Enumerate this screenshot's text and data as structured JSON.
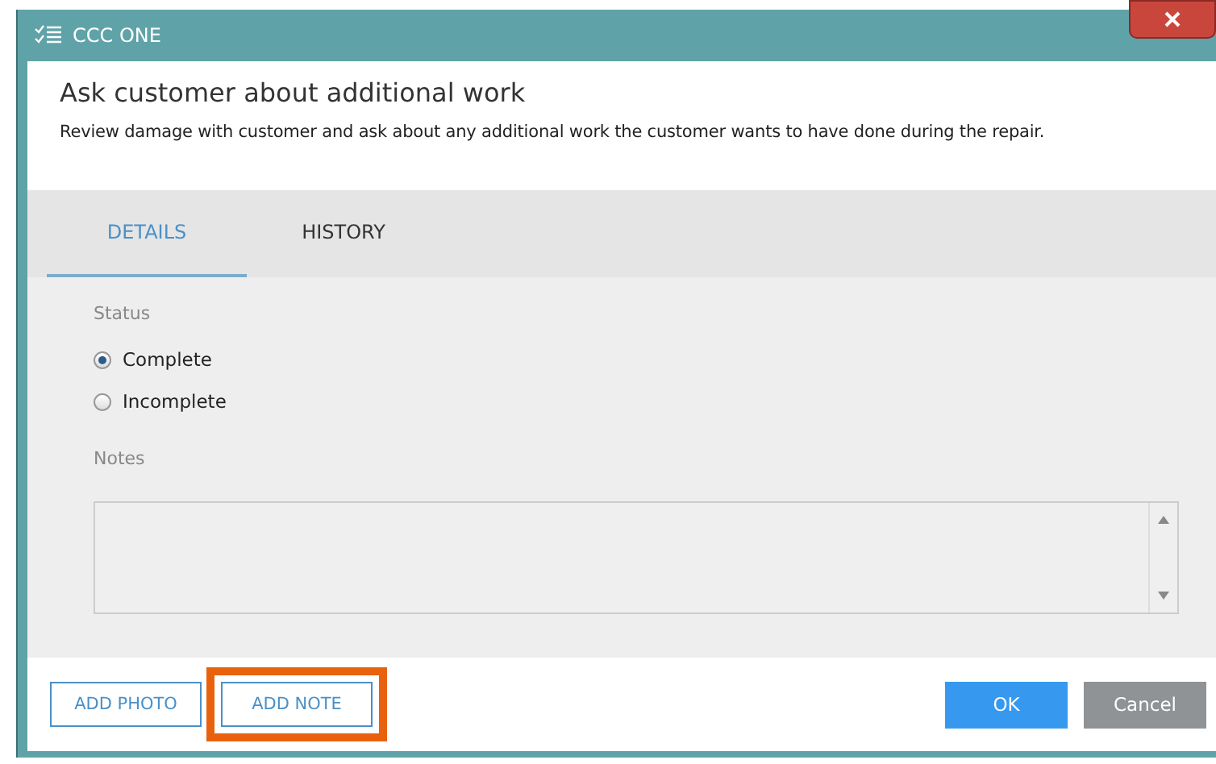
{
  "window": {
    "title": "CCC ONE"
  },
  "header": {
    "title": "Ask customer about additional work",
    "description": "Review damage with customer and ask about any additional work the customer wants to have done during the repair."
  },
  "tabs": [
    {
      "label": "DETAILS",
      "selected": true
    },
    {
      "label": "HISTORY",
      "selected": false
    }
  ],
  "status": {
    "label": "Status",
    "options": [
      {
        "label": "Complete",
        "selected": true
      },
      {
        "label": "Incomplete",
        "selected": false
      }
    ]
  },
  "notes": {
    "label": "Notes"
  },
  "footer_left_buttons": [
    {
      "label": "ADD PHOTO",
      "highlighted": false
    },
    {
      "label": "ADD NOTE",
      "highlighted": true
    }
  ],
  "footer_right_buttons": [
    {
      "label": "OK",
      "kind": "primary"
    },
    {
      "label": "Cancel",
      "kind": "secondary"
    }
  ]
}
